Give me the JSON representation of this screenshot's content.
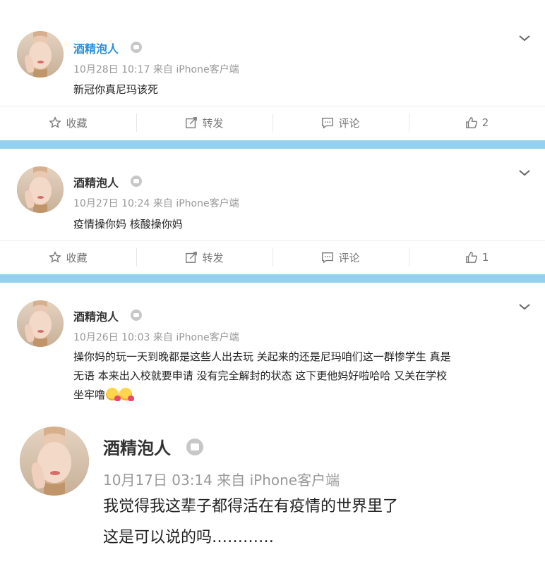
{
  "posts": [
    {
      "username": "酒精泡人",
      "meta": "10月28日 10:17 来自 iPhone客户端",
      "text": "新冠你真尼玛该死",
      "actions": {
        "favorite": "收藏",
        "repost": "转发",
        "comment": "评论",
        "likes": "2"
      }
    },
    {
      "username": "酒精泡人",
      "meta": "10月27日 10:24 来自 iPhone客户端",
      "text": "疫情操你妈 核酸操你妈",
      "actions": {
        "favorite": "收藏",
        "repost": "转发",
        "comment": "评论",
        "likes": "1"
      }
    },
    {
      "username": "酒精泡人",
      "meta": "10月26日 10:03 来自 iPhone客户端",
      "lines": [
        "操你妈的玩一天到晚都是这些人出去玩 关起来的还是尼玛咱们这一群惨学生 真是",
        "无语 本来出入校就要申请 没有完全解封的状态 这下更他妈好啦哈哈 又关在学校",
        "坐牢噜"
      ]
    },
    {
      "username": "酒精泡人",
      "meta": "10月17日 03:14 来自 iPhone客户端",
      "lines": [
        "我觉得我这辈子都得活在有疫情的世界里了",
        "这是可以说的吗…………"
      ]
    }
  ],
  "colors": {
    "separator": "#93d2ee",
    "name_link": "#2f8fd6"
  }
}
